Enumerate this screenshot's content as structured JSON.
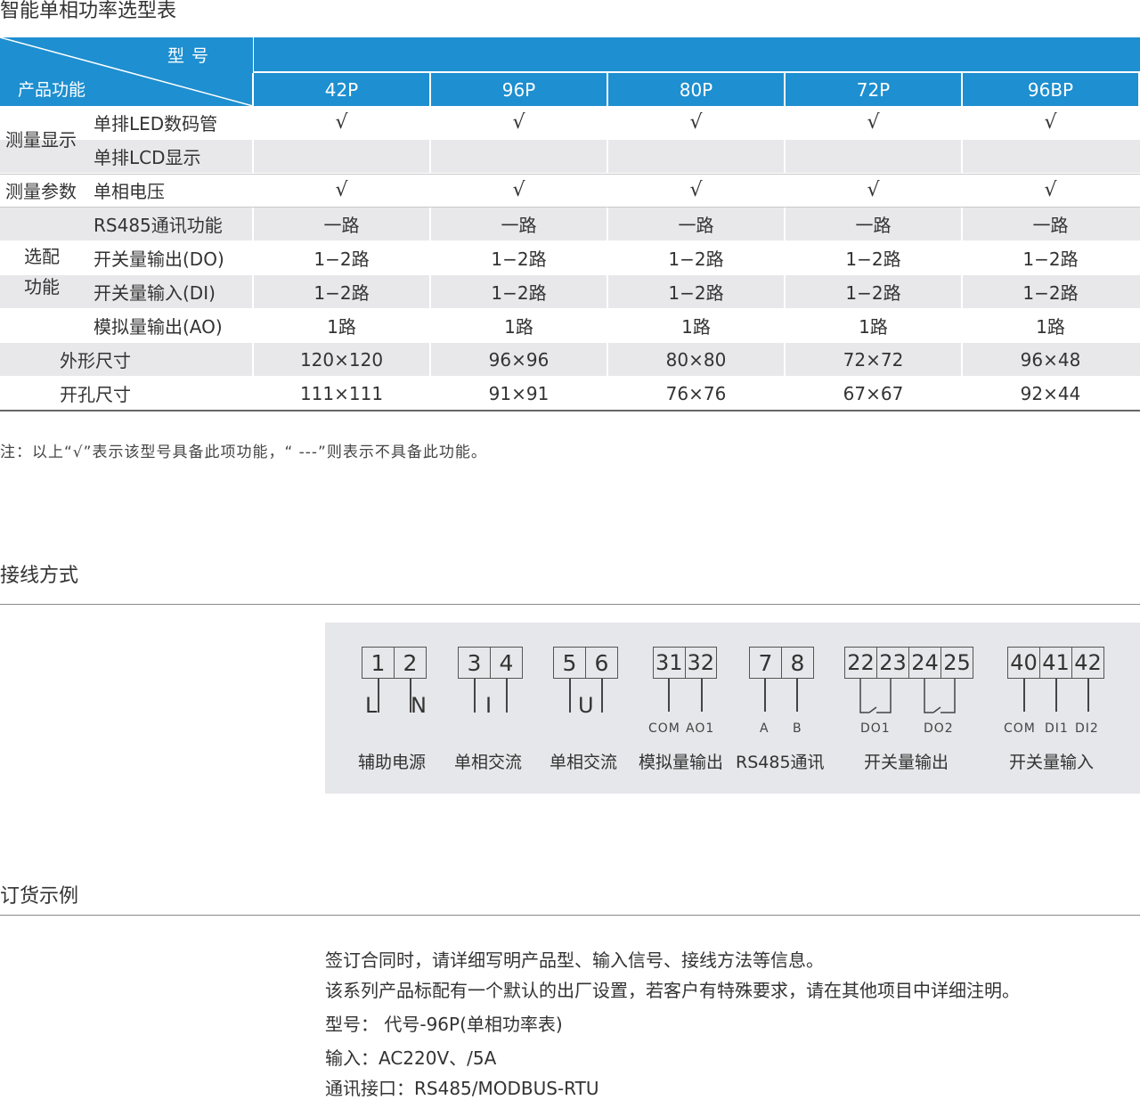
{
  "selection_table": {
    "title": "智能单相功率选型表",
    "header": {
      "model_label": "型号",
      "function_label": "产品功能"
    },
    "models": [
      "42P",
      "96P",
      "80P",
      "72P",
      "96BP"
    ],
    "groups": {
      "display": "测量显示",
      "params": "测量参数",
      "optional_line1": "选配",
      "optional_line2": "功能"
    },
    "rows": [
      {
        "name": "单排LED数码管",
        "values": [
          "√",
          "√",
          "√",
          "√",
          "√"
        ]
      },
      {
        "name": "单排LCD显示",
        "values": [
          "",
          "",
          "",
          "",
          ""
        ]
      },
      {
        "name": "单相电压",
        "values": [
          "√",
          "√",
          "√",
          "√",
          "√"
        ]
      },
      {
        "name": "RS485通讯功能",
        "values": [
          "一路",
          "一路",
          "一路",
          "一路",
          "一路"
        ]
      },
      {
        "name": "开关量输出(DO)",
        "values": [
          "1−2路",
          "1−2路",
          "1−2路",
          "1−2路",
          "1−2路"
        ]
      },
      {
        "name": "开关量输入(DI)",
        "values": [
          "1−2路",
          "1−2路",
          "1−2路",
          "1−2路",
          "1−2路"
        ]
      },
      {
        "name": "模拟量输出(AO)",
        "values": [
          "1路",
          "1路",
          "1路",
          "1路",
          "1路"
        ]
      },
      {
        "name": "外形尺寸",
        "values": [
          "120×120",
          "96×96",
          "80×80",
          "72×72",
          "96×48"
        ]
      },
      {
        "name": "开孔尺寸",
        "values": [
          "111×111",
          "91×91",
          "76×76",
          "67×67",
          "92×44"
        ]
      }
    ],
    "note": "注：以上“√”表示该型号具备此项功能，“ ---”则表示不具备此功能。"
  },
  "wiring": {
    "title": "接线方式",
    "groups": [
      {
        "terminals": [
          "1",
          "2"
        ],
        "wire_labels": [
          "L",
          "N"
        ],
        "sub_labels": [],
        "caption": "辅助电源"
      },
      {
        "terminals": [
          "3",
          "4"
        ],
        "wire_labels": [
          "I"
        ],
        "sub_labels": [],
        "caption": "单相交流"
      },
      {
        "terminals": [
          "5",
          "6"
        ],
        "wire_labels": [
          "U"
        ],
        "sub_labels": [],
        "caption": "单相交流"
      },
      {
        "terminals": [
          "31",
          "32"
        ],
        "wire_labels": [],
        "sub_labels": [
          "COM",
          "AO1"
        ],
        "caption": "模拟量输出"
      },
      {
        "terminals": [
          "7",
          "8"
        ],
        "wire_labels": [],
        "sub_labels": [
          "A",
          "B"
        ],
        "caption": "RS485通讯"
      },
      {
        "terminals": [
          "22",
          "23",
          "24",
          "25"
        ],
        "wire_labels": [],
        "sub_labels": [
          "DO1",
          "DO2"
        ],
        "caption": "开关量输出"
      },
      {
        "terminals": [
          "40",
          "41",
          "42"
        ],
        "wire_labels": [],
        "sub_labels": [
          "COM",
          "DI1",
          "DI2"
        ],
        "caption": "开关量输入"
      }
    ]
  },
  "order": {
    "title": "订货示例",
    "lines": [
      "签订合同时，请详细写明产品型、输入信号、接线方法等信息。",
      "该系列产品标配有一个默认的出厂设置，若客户有特殊要求，请在其他项目中详细注明。",
      "型号： 代号-96P(单相功率表)",
      "输入：AC220V、/5A",
      "通讯接口：RS485/MODBUS-RTU"
    ]
  },
  "colors": {
    "header_blue": "#1e8fd0",
    "row_gray": "#e8e8ea",
    "panel_gray": "#e6e7ea"
  }
}
